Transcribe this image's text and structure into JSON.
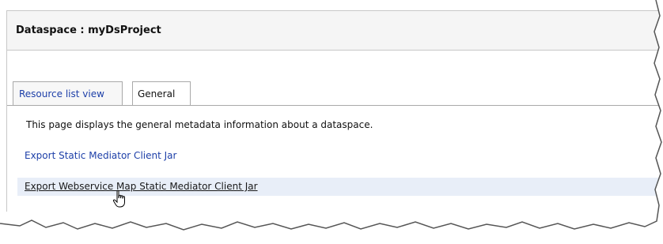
{
  "header": {
    "title": "Dataspace : myDsProject"
  },
  "tabs": [
    {
      "label": "Resource list view",
      "active": false
    },
    {
      "label": "General",
      "active": true
    }
  ],
  "panel": {
    "description": "This page displays the general metadata information about a dataspace.",
    "links": [
      {
        "label": "Export Static Mediator Client Jar"
      },
      {
        "label": "Export Webservice Map Static Mediator Client Jar",
        "hovered": true
      }
    ]
  },
  "icons": {
    "cursor": "hand-pointer-icon"
  },
  "colors": {
    "link": "#1d3fa8",
    "header_bg": "#f5f5f5",
    "hover_row_bg": "#e8eef8",
    "border": "#a9a9a9"
  }
}
